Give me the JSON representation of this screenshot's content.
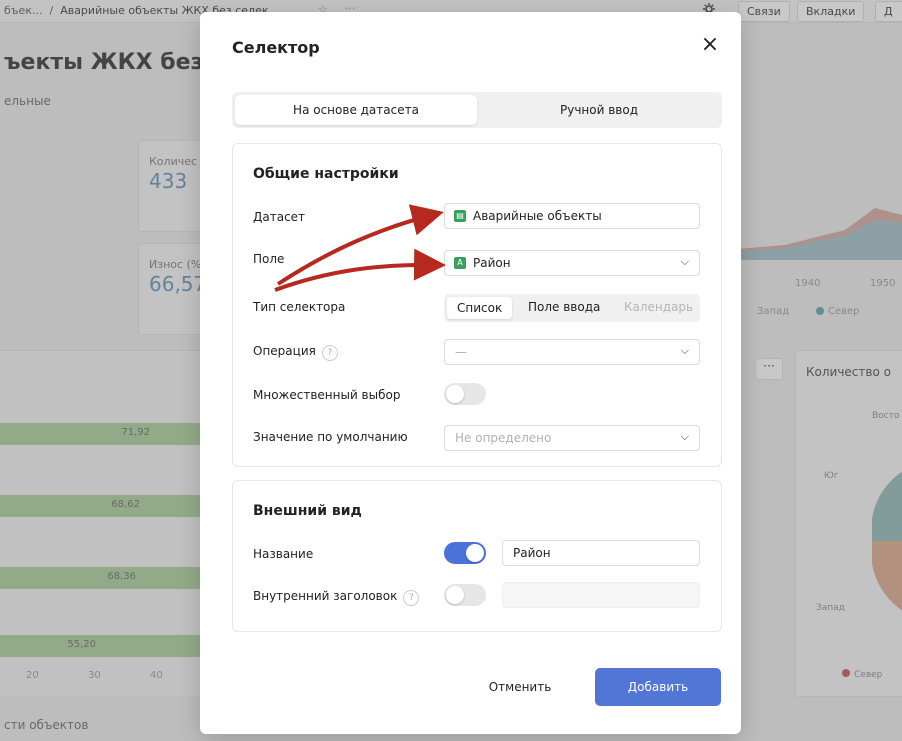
{
  "topbar": {
    "breadcrumb_prefix": "бъек...",
    "separator": "/",
    "breadcrumb_current": "Аварийные объекты ЖКХ без селек...",
    "star_icon": "☆",
    "more_icon": "···",
    "links_label": "Связи",
    "tabs_label": "Вкладки",
    "cut_button_label": "Д"
  },
  "dashboard": {
    "title": "ъекты ЖКХ без се",
    "subtitle": "ельные",
    "kpi1": {
      "label": "Количес",
      "value": "433"
    },
    "kpi2": {
      "label": "Износ (%",
      "value": "66,57"
    },
    "bar_values": [
      "71,92",
      "68,62",
      "68,36",
      "55,20"
    ],
    "x_ticks": [
      "20",
      "30",
      "40"
    ],
    "years": [
      "1940",
      "1950"
    ],
    "legend": [
      "Запад",
      "Север"
    ],
    "right_panel_title": "Количество о",
    "pie_labels": [
      "Восто",
      "Юг",
      "Запад"
    ],
    "pie_legend": "Север",
    "bottom_caption": "сти объектов",
    "dots_label": "···"
  },
  "modal": {
    "title": "Селектор",
    "close_icon": "×",
    "tabs": [
      {
        "label": "На основе датасета",
        "active": true
      },
      {
        "label": "Ручной ввод",
        "active": false
      }
    ],
    "general": {
      "title": "Общие настройки",
      "dataset_label": "Датасет",
      "dataset_value": "Аварийные объекты",
      "field_label": "Поле",
      "field_value": "Район",
      "field_badge": "A",
      "selector_type_label": "Тип селектора",
      "selector_types": [
        "Список",
        "Поле ввода",
        "Календарь"
      ],
      "selector_type_selected": "Список",
      "operation_label": "Операция",
      "operation_value": "—",
      "multi_label": "Множественный выбор",
      "multi_enabled": false,
      "default_label": "Значение по умолчанию",
      "default_placeholder": "Не определено",
      "help_icon": "?"
    },
    "appearance": {
      "title": "Внешний вид",
      "name_label": "Название",
      "name_enabled": true,
      "name_value": "Район",
      "inner_label": "Внутренний заголовок",
      "inner_enabled": false,
      "inner_value": ""
    },
    "cancel_label": "Отменить",
    "add_label": "Добавить"
  },
  "colors": {
    "accent": "#5276d6",
    "annotation_arrow": "#b5291f",
    "dataset_icon": "#3aa15c"
  }
}
